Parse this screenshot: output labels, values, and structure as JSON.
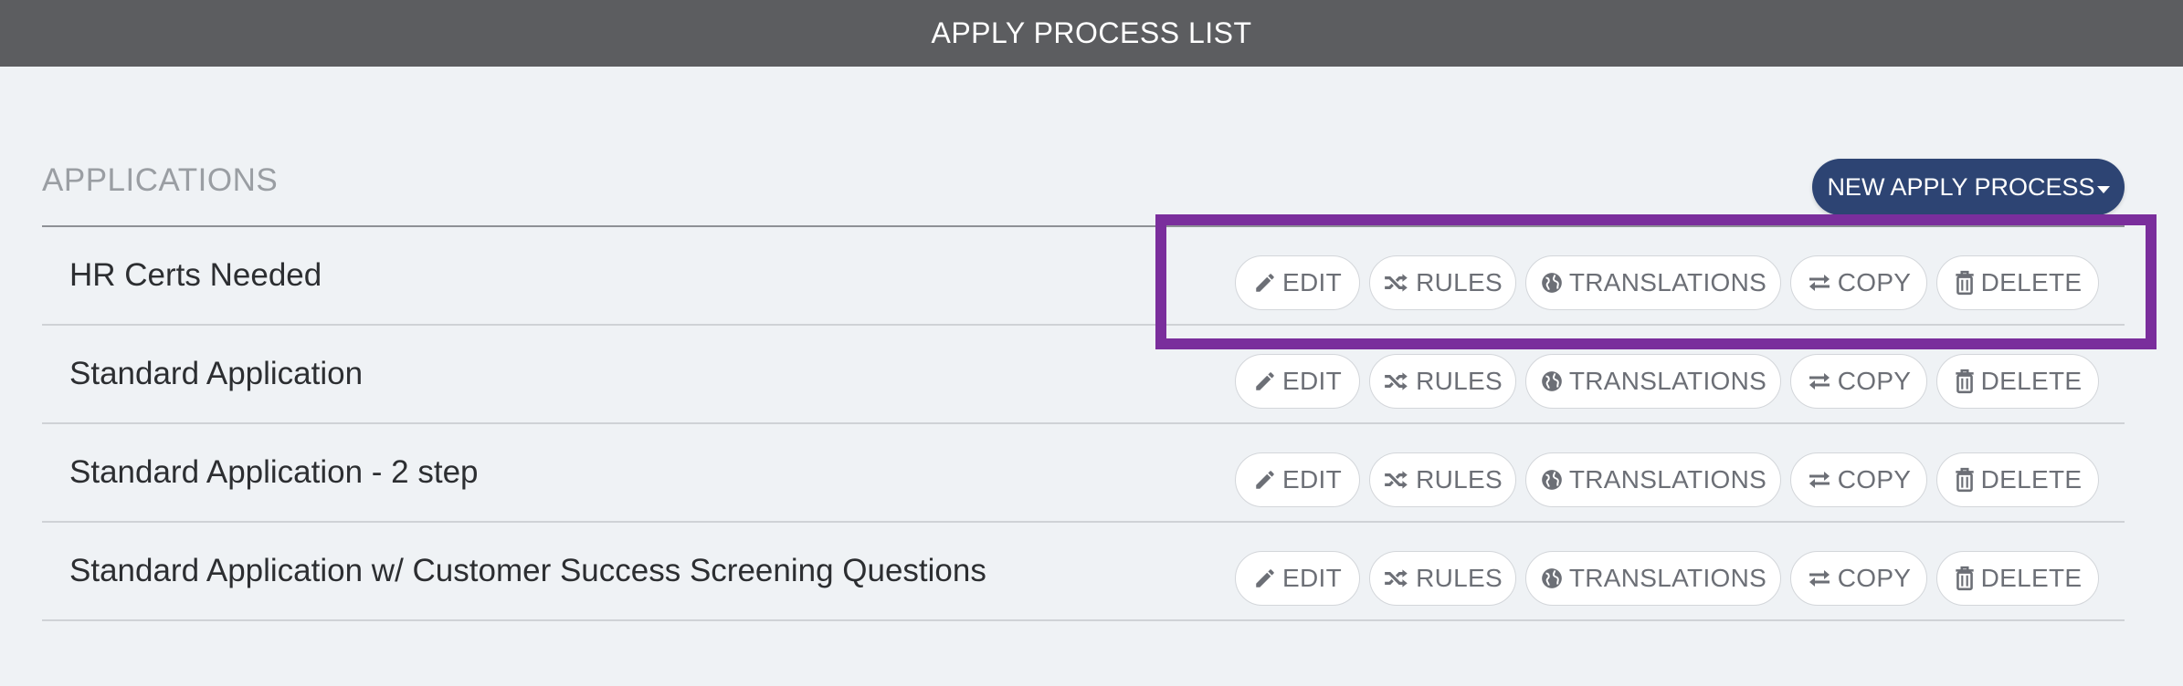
{
  "header": {
    "title": "APPLY PROCESS LIST"
  },
  "section": {
    "title": "APPLICATIONS",
    "new_button_label": "NEW APPLY PROCESS"
  },
  "actions": {
    "edit": "EDIT",
    "rules": "RULES",
    "translations": "TRANSLATIONS",
    "copy": "COPY",
    "delete": "DELETE"
  },
  "rows": [
    {
      "title": "HR Certs Needed"
    },
    {
      "title": "Standard Application"
    },
    {
      "title": "Standard Application - 2 step"
    },
    {
      "title": "Standard Application w/ Customer Success Screening Questions"
    }
  ],
  "icons": {
    "edit": "pencil-icon",
    "rules": "shuffle-icon",
    "translations": "globe-icon",
    "copy": "swap-arrows-icon",
    "delete": "trash-icon"
  },
  "colors": {
    "topbar": "#5c5d60",
    "primary_button": "#2d4473",
    "highlight": "#7a2e9c",
    "background": "#eff2f5"
  }
}
